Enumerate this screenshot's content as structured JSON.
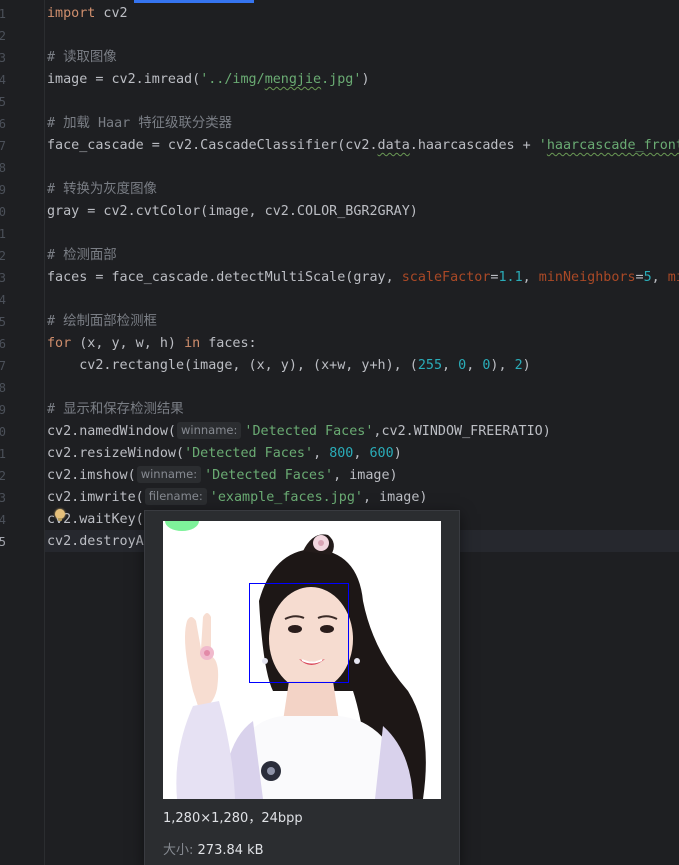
{
  "gutter": {
    "line_numbers": [
      "1",
      "2",
      "3",
      "4",
      "5",
      "6",
      "7",
      "8",
      "9",
      "0",
      "1",
      "2",
      "3",
      "4",
      "5",
      "6",
      "7",
      "8",
      "9",
      "0",
      "1",
      "2",
      "3",
      "4",
      "5"
    ],
    "active_line": "5"
  },
  "code": {
    "l1_kw": "import",
    "l1_rest": " cv2",
    "l3": "# 读取图像",
    "l4_a": "image = cv2.imread(",
    "l4_s1": "'../img/",
    "l4_s2": "mengjie",
    "l4_s3": ".jpg'",
    "l4_b": ")",
    "l6": "# 加载 Haar 特征级联分类器",
    "l7_a": "face_cascade = cv2.CascadeClassifier(cv2.",
    "l7_b": "data",
    "l7_c": ".haarcascades + ",
    "l7_s1": "'",
    "l7_s2": "haarcascade_frontal",
    "l9": "# 转换为灰度图像",
    "l10": "gray = cv2.cvtColor(image, cv2.COLOR_BGR2GRAY)",
    "l12": "# 检测面部",
    "l13_a": "faces = face_cascade.detectMultiScale(gray, ",
    "l13_p1": "scaleFactor",
    "l13_eq1": "=",
    "l13_n1": "1.1",
    "l13_c1": ", ",
    "l13_p2": "minNeighbors",
    "l13_eq2": "=",
    "l13_n2": "5",
    "l13_c2": ", ",
    "l13_p3": "mi",
    "l15": "# 绘制面部检测框",
    "l16_kw1": "for",
    "l16_a": " (x, y, w, h) ",
    "l16_kw2": "in",
    "l16_b": " faces:",
    "l17_a": "    cv2.rectangle(image, (x, y), (x+w, y+h), (",
    "l17_n1": "255",
    "l17_c1": ", ",
    "l17_n2": "0",
    "l17_c2": ", ",
    "l17_n3": "0",
    "l17_b": "), ",
    "l17_n4": "2",
    "l17_c": ")",
    "l19": "# 显示和保存检测结果",
    "l20_a": "cv2.namedWindow(",
    "l20_hint": "winname:",
    "l20_s": "'Detected Faces'",
    "l20_b": ",cv2.WINDOW_FREERATIO)",
    "l21_a": "cv2.resizeWindow(",
    "l21_s": "'Detected Faces'",
    "l21_c1": ", ",
    "l21_n1": "800",
    "l21_c2": ", ",
    "l21_n2": "600",
    "l21_b": ")",
    "l22_a": "cv2.imshow(",
    "l22_hint": "winname:",
    "l22_s": "'Detected Faces'",
    "l22_b": ", image)",
    "l23_a": "cv2.imwrite(",
    "l23_hint": "filename:",
    "l23_s": "'example_faces.jpg'",
    "l23_b": ", image)",
    "l24": "cv2.waitKey(",
    "l25": "cv2.destroyA"
  },
  "image_preview": {
    "dimensions": "1,280×1,280，24bpp",
    "size_label": "大小:",
    "size_value": "273.84 kB"
  },
  "colors": {
    "background": "#1e1f22",
    "keyword": "#cf8e6d",
    "string": "#6aab73",
    "number": "#2aacb8",
    "comment": "#7a7e85",
    "face_box": "#0000ff"
  }
}
